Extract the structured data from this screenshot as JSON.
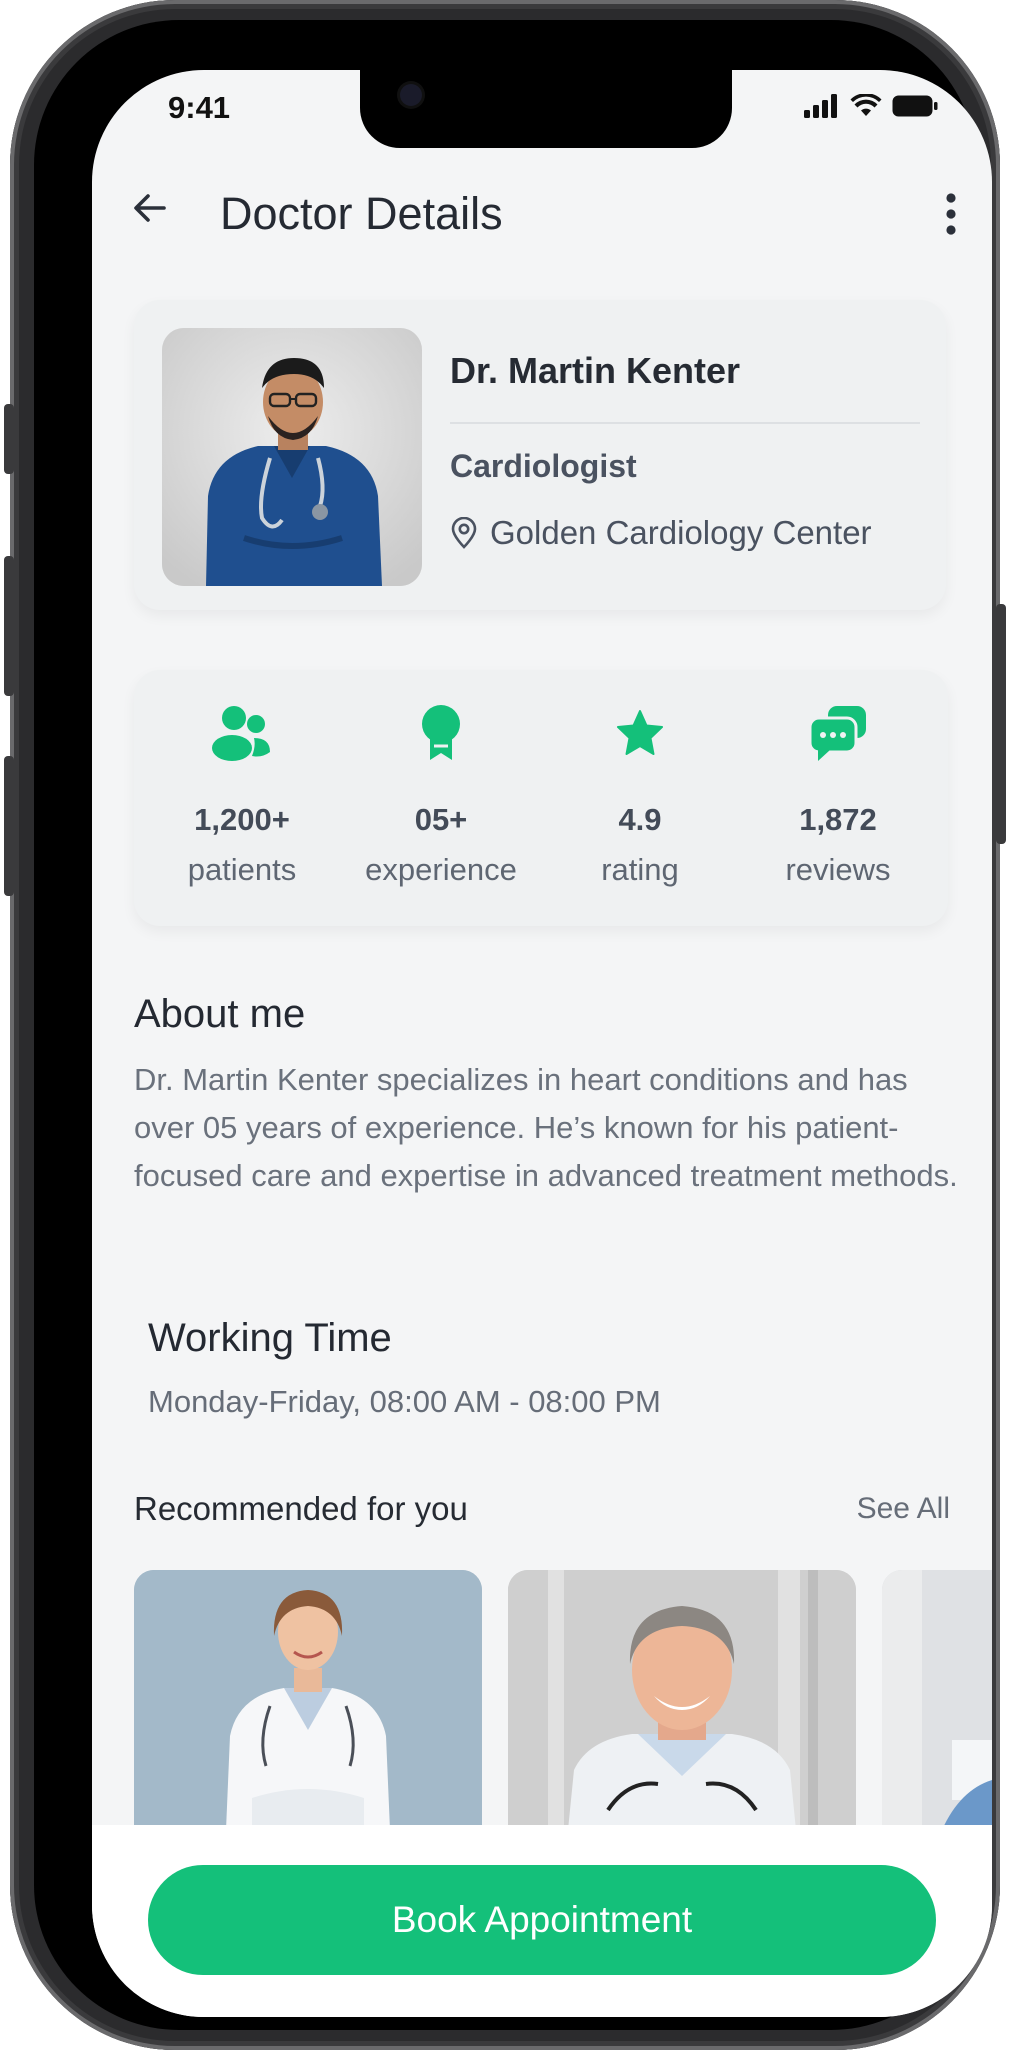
{
  "status_bar": {
    "time": "9:41"
  },
  "header": {
    "title": "Doctor Details"
  },
  "doctor": {
    "name": "Dr. Martin Kenter",
    "specialty": "Cardiologist",
    "location": "Golden Cardiology Center"
  },
  "stats": [
    {
      "icon": "patients-icon",
      "value": "1,200+",
      "label": "patients"
    },
    {
      "icon": "award-icon",
      "value": "05+",
      "label": "experience"
    },
    {
      "icon": "star-icon",
      "value": "4.9",
      "label": "rating"
    },
    {
      "icon": "chat-bubbles-icon",
      "value": "1,872",
      "label": "reviews"
    }
  ],
  "about": {
    "title": "About me",
    "text": "Dr. Martin Kenter specializes in heart conditions and has over 05 years of experience. He’s known for his patient-focused care and expertise in advanced treatment methods."
  },
  "working_time": {
    "title": "Working Time",
    "text": "Monday-Friday, 08:00 AM - 08:00 PM"
  },
  "recommended": {
    "title": "Recommended for you",
    "see_all": "See All"
  },
  "cta": {
    "label": "Book Appointment"
  },
  "colors": {
    "accent": "#14c07a",
    "background": "#f4f5f6",
    "text": "#262b33"
  }
}
